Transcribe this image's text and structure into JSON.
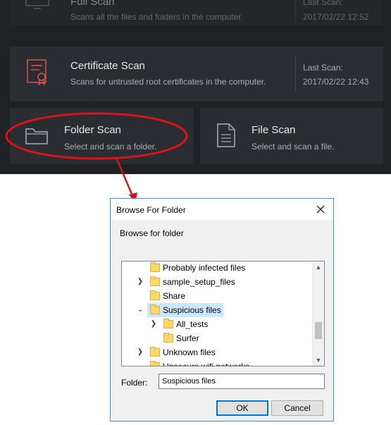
{
  "scan_panel": {
    "full_scan": {
      "title": "Full Scan",
      "description": "Scans all the files and folders in the computer.",
      "last_scan_label": "Last Scan:",
      "last_scan_value": "2017/02/22 12:52"
    },
    "certificate_scan": {
      "title": "Certificate Scan",
      "description": "Scans for untrusted root certificates in the computer.",
      "last_scan_label": "Last Scan:",
      "last_scan_value": "2017/02/22 12:43"
    },
    "folder_scan": {
      "title": "Folder Scan",
      "description": "Select and scan a folder."
    },
    "file_scan": {
      "title": "File Scan",
      "description": "Select and scan a file."
    }
  },
  "dialog": {
    "title": "Browse For Folder",
    "prompt": "Browse for folder",
    "tree": [
      {
        "label": "Probably infected files",
        "selected": false
      },
      {
        "label": "sample_setup_files",
        "selected": false
      },
      {
        "label": "Share",
        "selected": false
      },
      {
        "label": "Suspicious files",
        "selected": true
      },
      {
        "label": "All_tests",
        "selected": false
      },
      {
        "label": "Surfer",
        "selected": false
      },
      {
        "label": "Unknown files",
        "selected": false
      },
      {
        "label": "Unsecure wifi networks",
        "selected": false
      }
    ],
    "folder_label": "Folder:",
    "folder_value": "Suspicious files",
    "ok_label": "OK",
    "cancel_label": "Cancel"
  },
  "colors": {
    "callout": "#d7141a",
    "cert_icon": "#d9534f",
    "selection": "#cce8ff",
    "dialog_border": "#3c94d6"
  }
}
